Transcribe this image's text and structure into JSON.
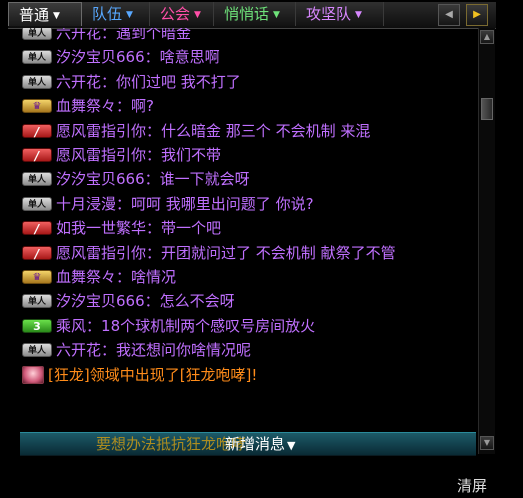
{
  "tabs": [
    {
      "label": "普通",
      "color": "#ffffff"
    },
    {
      "label": "队伍",
      "color": "#58a8ff"
    },
    {
      "label": "公会",
      "color": "#ff4fa8"
    },
    {
      "label": "悄悄话",
      "color": "#6ee37a"
    },
    {
      "label": "攻坚队",
      "color": "#d888ff"
    }
  ],
  "tab_nav": {
    "prev_icon": "triangle-left-icon",
    "next_icon": "triangle-right-icon"
  },
  "chat": {
    "lines": [
      {
        "badge": "单人",
        "badge_type": "single",
        "speaker": "六开花",
        "sep": "：",
        "text": "遇到个暗金",
        "speaker_color": "#c070ff",
        "text_color": "#c070ff"
      },
      {
        "badge": "单人",
        "badge_type": "single",
        "speaker": "汐汐宝贝666",
        "sep": "：",
        "text": "啥意思啊",
        "speaker_color": "#c070ff",
        "text_color": "#c070ff"
      },
      {
        "badge": "单人",
        "badge_type": "single",
        "speaker": "六开花",
        "sep": "：",
        "text": "你们过吧   我不打了",
        "speaker_color": "#c070ff",
        "text_color": "#c070ff"
      },
      {
        "badge": "♛",
        "badge_type": "crown",
        "speaker": "血舞祭々",
        "sep": "：",
        "text": "啊?",
        "speaker_color": "#c070ff",
        "text_color": "#c070ff"
      },
      {
        "badge": "/",
        "badge_type": "slash",
        "speaker": "愿风雷指引你",
        "sep": "：",
        "text": "什么暗金  那三个  不会机制  来混",
        "speaker_color": "#c070ff",
        "text_color": "#c070ff"
      },
      {
        "badge": "/",
        "badge_type": "slash",
        "speaker": "愿风雷指引你",
        "sep": "：",
        "text": "我们不带",
        "speaker_color": "#c070ff",
        "text_color": "#c070ff"
      },
      {
        "badge": "单人",
        "badge_type": "single",
        "speaker": "汐汐宝贝666",
        "sep": "：",
        "text": "谁一下就会呀",
        "speaker_color": "#c070ff",
        "text_color": "#c070ff"
      },
      {
        "badge": "单人",
        "badge_type": "single",
        "speaker": "十月浸漫",
        "sep": "：",
        "text": "呵呵  我哪里出问题了  你说?",
        "speaker_color": "#c070ff",
        "text_color": "#c070ff"
      },
      {
        "badge": "/",
        "badge_type": "slash",
        "speaker": "如我一世繁华",
        "sep": "：",
        "text": "带一个吧",
        "speaker_color": "#c070ff",
        "text_color": "#c070ff"
      },
      {
        "badge": "/",
        "badge_type": "slash",
        "speaker": "愿风雷指引你",
        "sep": "：",
        "text": "开团就问过了  不会机制  献祭了不管",
        "speaker_color": "#c070ff",
        "text_color": "#c070ff"
      },
      {
        "badge": "♛",
        "badge_type": "crown",
        "speaker": "血舞祭々",
        "sep": "：",
        "text": "啥情况",
        "speaker_color": "#c070ff",
        "text_color": "#c070ff"
      },
      {
        "badge": "单人",
        "badge_type": "single",
        "speaker": "汐汐宝贝666",
        "sep": "：",
        "text": "怎么不会呀",
        "speaker_color": "#c070ff",
        "text_color": "#c070ff"
      },
      {
        "badge": "3",
        "badge_type": "num",
        "speaker": "乘风",
        "sep": "：",
        "text": "18个球机制两个感叹号房间放火",
        "speaker_color": "#c070ff",
        "text_color": "#c070ff"
      },
      {
        "badge": "单人",
        "badge_type": "single",
        "speaker": "六开花",
        "sep": "：",
        "text": "我还想问你啥情况呢",
        "speaker_color": "#c070ff",
        "text_color": "#c070ff"
      },
      {
        "badge": "",
        "badge_type": "avatar",
        "speaker": "",
        "sep": "",
        "text": "[狂龙]领域中出现了[狂龙咆哮]!",
        "speaker_color": "#ff8c1a",
        "text_color": "#ff8c1a"
      }
    ]
  },
  "bottom": {
    "ghost_text": "要想办法抵抗狂龙咆哮",
    "new_message_label": "新增消息",
    "new_message_icon": "triangle-down-icon",
    "clear_label": "清屏"
  },
  "scrollbar": {
    "up_icon": "triangle-up-icon",
    "down_icon": "triangle-down-icon"
  }
}
